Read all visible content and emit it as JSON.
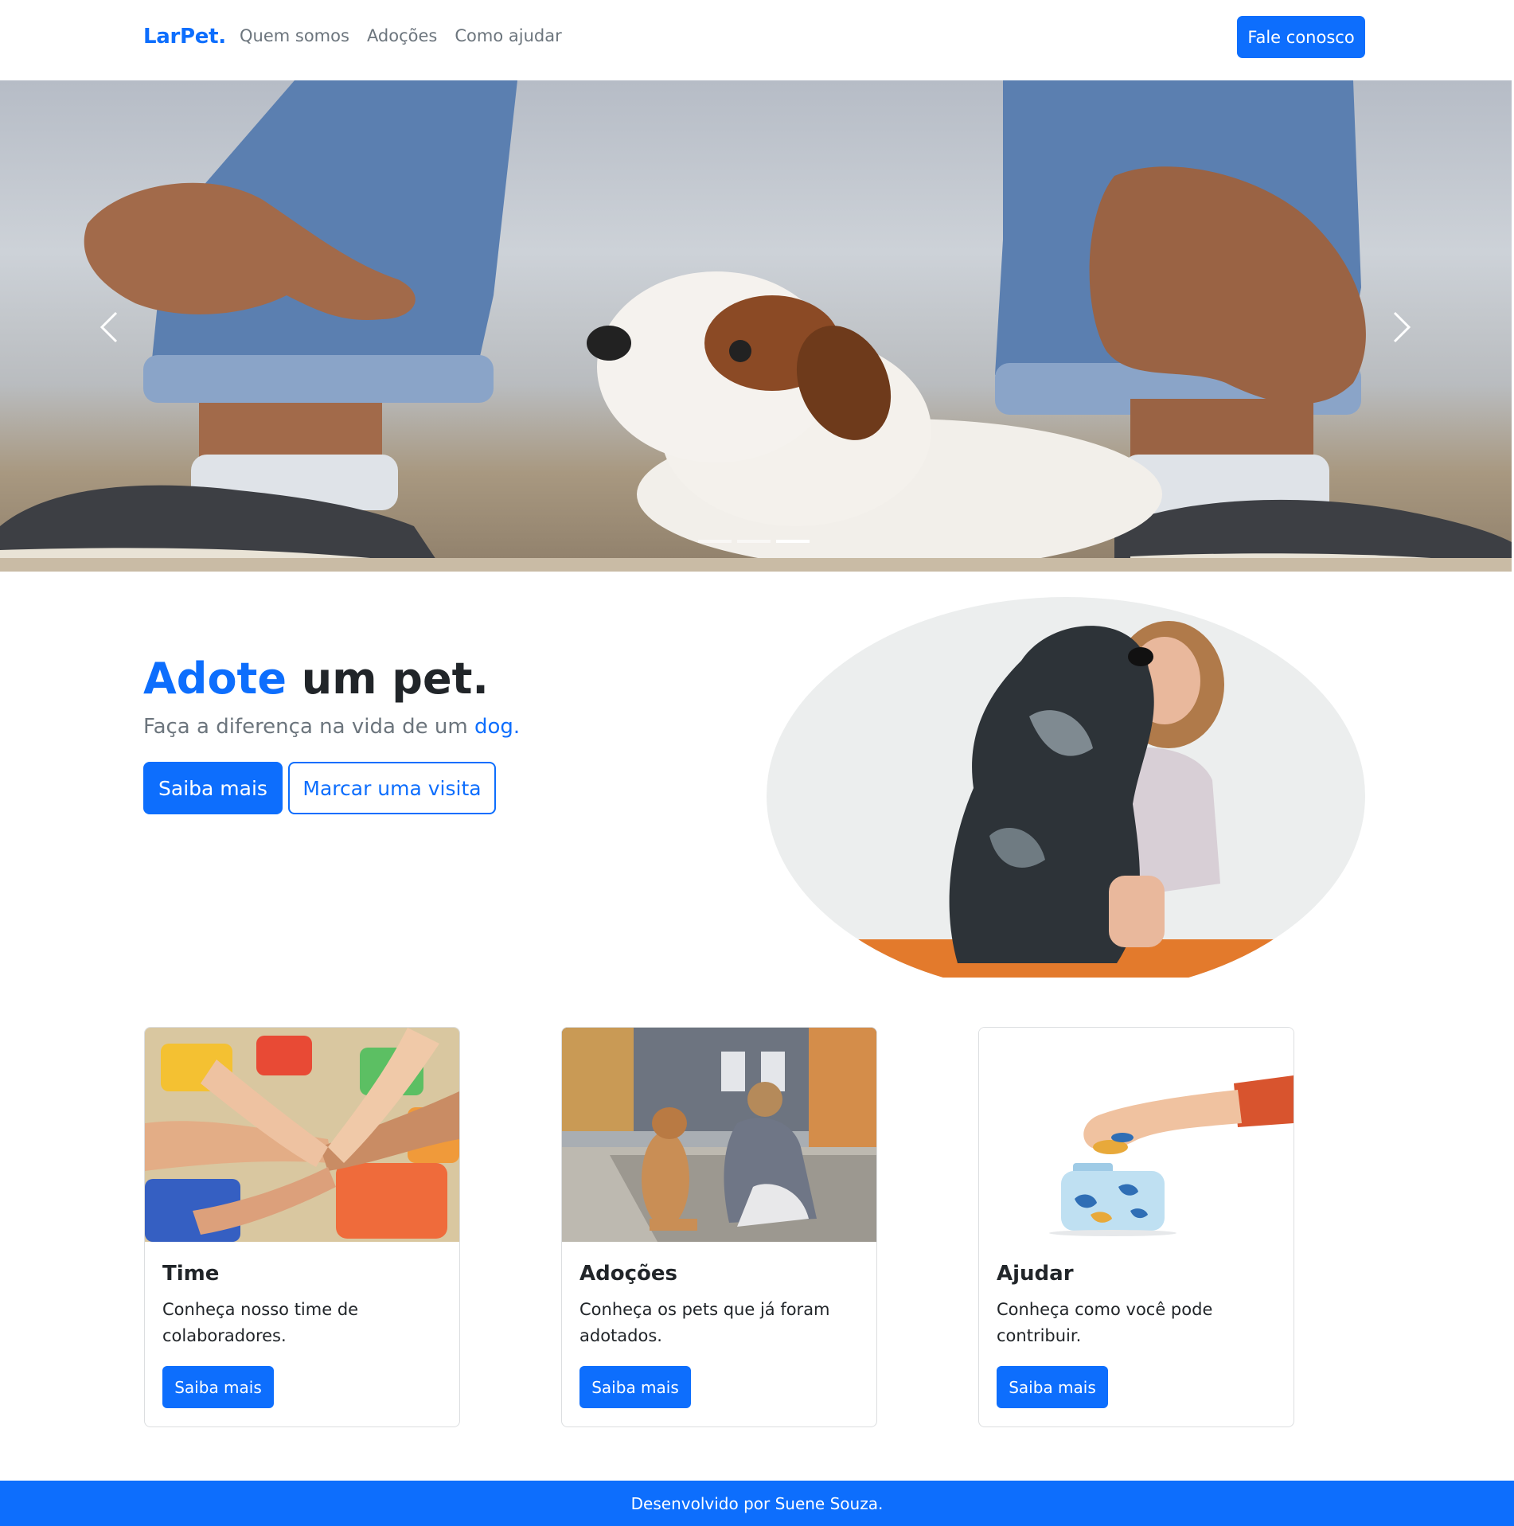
{
  "navbar": {
    "brand": "LarPet.",
    "links": [
      "Quem somos",
      "Adoções",
      "Como ajudar"
    ],
    "cta": "Fale conosco"
  },
  "carousel": {
    "slide_count": 3,
    "active_index": 2,
    "prev_icon": "chevron-left-icon",
    "next_icon": "chevron-right-icon"
  },
  "hero": {
    "title_accent": "Adote",
    "title_rest": " um pet.",
    "subtitle_main": "Faça a diferença na vida de um ",
    "subtitle_accent": "dog.",
    "primary_button": "Saiba mais",
    "secondary_button": "Marcar uma visita"
  },
  "cards": [
    {
      "title": "Time",
      "text": "Conheça nosso time de colaboradores.",
      "button": "Saiba mais"
    },
    {
      "title": "Adoções",
      "text": "Conheça os pets que já foram adotados.",
      "button": "Saiba mais"
    },
    {
      "title": "Ajudar",
      "text": "Conheça como você pode contribuir.",
      "button": "Saiba mais"
    }
  ],
  "footer": {
    "text": "Desenvolvido por Suene Souza."
  },
  "colors": {
    "primary": "#0d6efd",
    "muted": "#6c757d",
    "text": "#212529"
  }
}
